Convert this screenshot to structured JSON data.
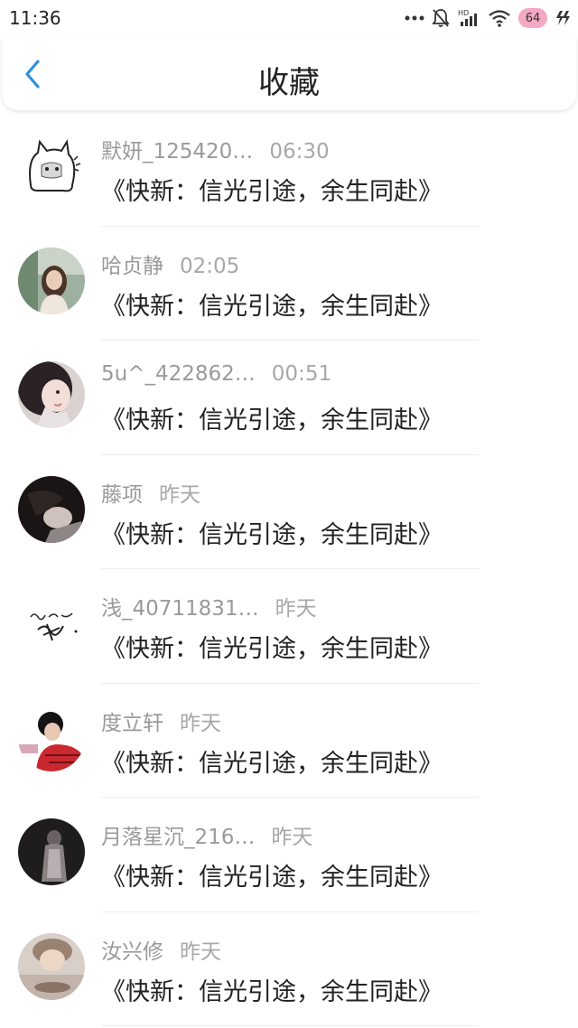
{
  "status_bar": {
    "time": "11:36",
    "battery": "64"
  },
  "header": {
    "title": "收藏"
  },
  "items": [
    {
      "name": "默妍_125420…",
      "time": "06:30",
      "title": "《快新：信光引途，余生同赴》"
    },
    {
      "name": "哈贞静",
      "time": "02:05",
      "title": "《快新：信光引途，余生同赴》"
    },
    {
      "name": "5u^_422862…",
      "time": "00:51",
      "title": "《快新：信光引途，余生同赴》"
    },
    {
      "name": "藤项",
      "time": "昨天",
      "title": "《快新：信光引途，余生同赴》"
    },
    {
      "name": "浅_40711831…",
      "time": "昨天",
      "title": "《快新：信光引途，余生同赴》"
    },
    {
      "name": "度立轩",
      "time": "昨天",
      "title": "《快新：信光引途，余生同赴》"
    },
    {
      "name": "月落星沉_216…",
      "time": "昨天",
      "title": "《快新：信光引途，余生同赴》"
    },
    {
      "name": "汝兴修",
      "time": "昨天",
      "title": "《快新：信光引途，余生同赴》"
    }
  ],
  "colors": {
    "accent": "#2f8fe0",
    "text": "#222222",
    "secondary_text": "#9a9a9a"
  }
}
